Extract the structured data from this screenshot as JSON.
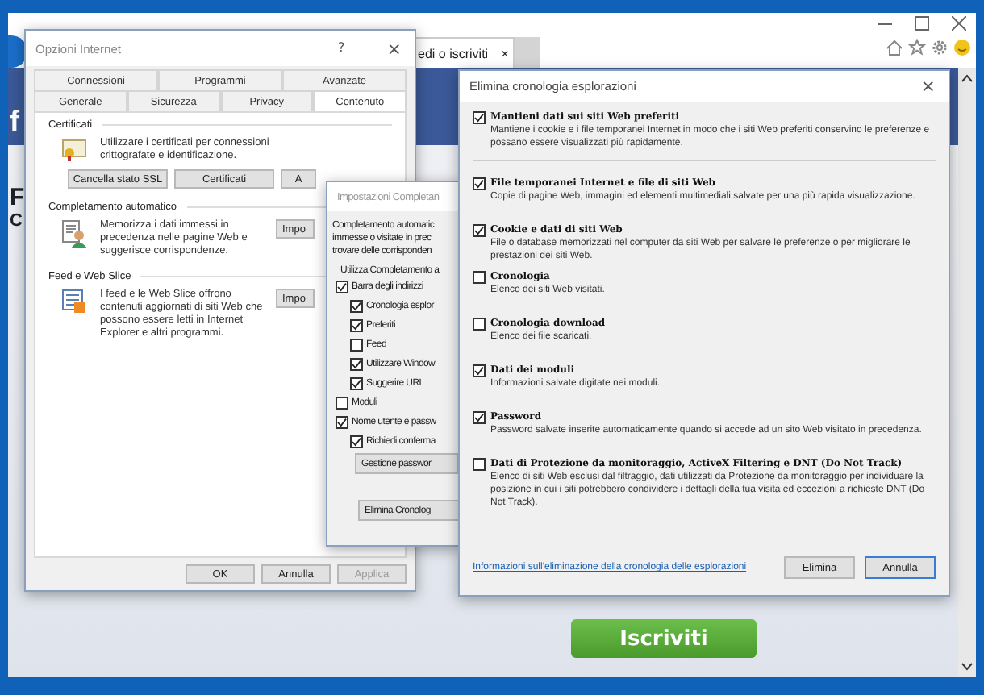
{
  "browser": {
    "tab_title": "edi o iscriviti",
    "tab_close": "×"
  },
  "page": {
    "logo_letter": "f",
    "heading_letter": "F",
    "subheading_letter": "C",
    "signup_button": "Iscriviti"
  },
  "internet_options": {
    "title": "Opzioni Internet",
    "help": "?",
    "close": "×",
    "tab_rows": [
      [
        {
          "label": "Connessioni",
          "selected": false
        },
        {
          "label": "Programmi",
          "selected": false
        },
        {
          "label": "Avanzate",
          "selected": false
        }
      ],
      [
        {
          "label": "Generale",
          "selected": false
        },
        {
          "label": "Sicurezza",
          "selected": false
        },
        {
          "label": "Privacy",
          "selected": false
        },
        {
          "label": "Contenuto",
          "selected": true
        }
      ]
    ],
    "sections": [
      {
        "kind": "certificate",
        "title": "Certificati",
        "text": "Utilizzare i certificati per connessioni crittografate e identificazione.",
        "buttons": [
          "Cancella stato SSL",
          "Certificati",
          "A"
        ]
      },
      {
        "kind": "autocomplete",
        "title": "Completamento automatico",
        "text": "Memorizza i dati immessi in precedenza nelle pagine Web e suggerisce corrispondenze.",
        "buttons": [
          "Impo"
        ]
      },
      {
        "kind": "feed",
        "title": "Feed e Web Slice",
        "text": "I feed e le Web Slice offrono contenuti aggiornati di siti Web che possono essere letti in Internet Explorer e altri programmi.",
        "buttons": [
          "Impo"
        ]
      }
    ],
    "footer_buttons": [
      {
        "label": "OK",
        "disabled": false
      },
      {
        "label": "Annulla",
        "disabled": false
      },
      {
        "label": "Applica",
        "disabled": true
      }
    ]
  },
  "autocomplete_settings": {
    "title": "Impostazioni Completan",
    "description_lines": [
      "Completamento automatic",
      "immesse o visitate in prec",
      "trovare delle corrisponden"
    ],
    "group_label": "Utilizza Completamento a",
    "options": [
      {
        "label": "Barra degli indirizzi",
        "checked": true,
        "children": [
          {
            "label": "Cronologia esplor",
            "checked": true
          },
          {
            "label": "Preferiti",
            "checked": true
          },
          {
            "label": "Feed",
            "checked": false
          },
          {
            "label": "Utilizzare Window",
            "checked": true
          },
          {
            "label": "Suggerire URL",
            "checked": true
          }
        ]
      },
      {
        "label": "Moduli",
        "checked": false
      },
      {
        "label": "Nome utente e passw",
        "checked": true,
        "children": [
          {
            "label": "Richiedi conferma",
            "checked": true
          }
        ]
      }
    ],
    "group_button": "Gestione passwor",
    "bottom_button": "Elimina Cronolog"
  },
  "delete_history": {
    "title": "Elimina cronologia esplorazioni",
    "close": "×",
    "items": [
      {
        "title": "Mantieni dati sui siti Web preferiti",
        "description": "Mantiene i cookie e i file temporanei Internet in modo che i siti Web preferiti conservino le preferenze e possano essere visualizzati più rapidamente.",
        "checked": true
      },
      {
        "title": "File temporanei Internet e file di siti Web",
        "description": "Copie di pagine Web, immagini ed elementi multimediali salvate per una più rapida visualizzazione.",
        "checked": true
      },
      {
        "title": "Cookie e dati di siti Web",
        "description": "File o database memorizzati nel computer da siti Web per salvare le preferenze o per migliorare le prestazioni dei siti Web.",
        "checked": true
      },
      {
        "title": "Cronologia",
        "description": "Elenco dei siti Web visitati.",
        "checked": false
      },
      {
        "title": "Cronologia download",
        "description": "Elenco dei file scaricati.",
        "checked": false
      },
      {
        "title": "Dati dei moduli",
        "description": "Informazioni salvate digitate nei moduli.",
        "checked": true
      },
      {
        "title": "Password",
        "description": "Password salvate inserite automaticamente quando si accede ad un sito Web visitato in precedenza.",
        "checked": true
      },
      {
        "title": "Dati di Protezione da monitoraggio, ActiveX Filtering e DNT (Do Not Track)",
        "description": "Elenco di siti Web esclusi dal filtraggio, dati utilizzati da Protezione da monitoraggio per individuare la posizione in cui i siti potrebbero condividere i dettagli della tua visita ed eccezioni a richieste DNT (Do Not Track).",
        "checked": false
      }
    ],
    "link": "Informazioni sull'eliminazione della cronologia delle esplorazioni",
    "buttons": [
      {
        "label": "Elimina",
        "focused": false
      },
      {
        "label": "Annulla",
        "focused": true
      }
    ]
  }
}
